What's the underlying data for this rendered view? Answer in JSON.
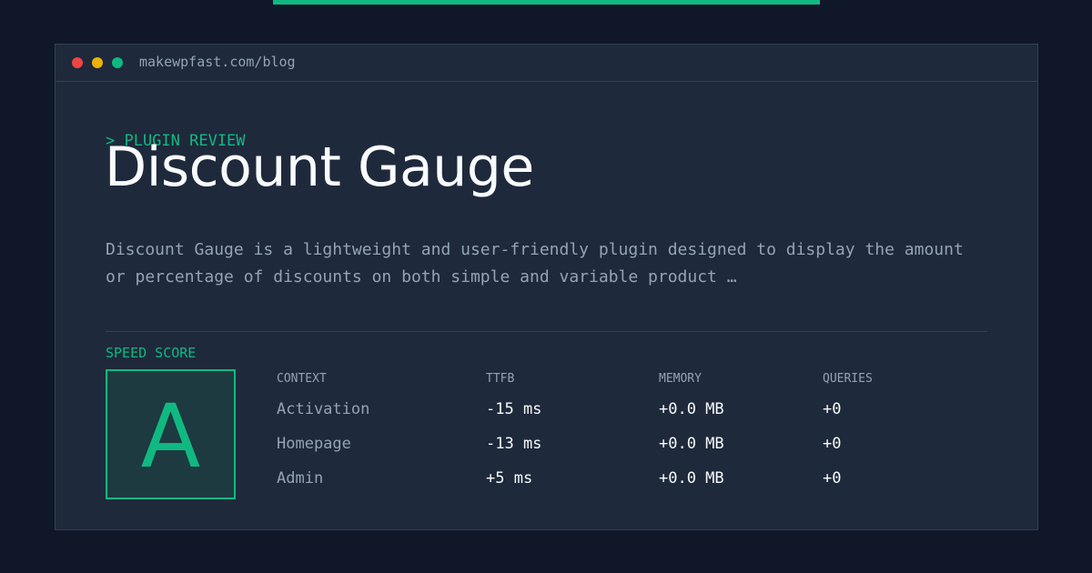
{
  "window": {
    "url": "makewpfast.com/blog"
  },
  "article": {
    "eyebrow": "> PLUGIN REVIEW",
    "title": "Discount Gauge",
    "description": "Discount Gauge is a lightweight and user-friendly plugin designed to display the amount or percentage of discounts on both simple and variable product …"
  },
  "speed": {
    "label": "SPEED SCORE",
    "grade": "A"
  },
  "metrics": {
    "headers": [
      "CONTEXT",
      "TTFB",
      "MEMORY",
      "QUERIES"
    ],
    "rows": [
      [
        "Activation",
        "-15 ms",
        "+0.0 MB",
        "+0"
      ],
      [
        "Homepage",
        "-13 ms",
        "+0.0 MB",
        "+0"
      ],
      [
        "Admin",
        "+5 ms",
        "+0.0 MB",
        "+0"
      ]
    ]
  },
  "colors": {
    "accent": "#10b981",
    "background": "#0f1729",
    "panel": "#1e293b",
    "muted": "#94a3b8",
    "text": "#f8fafc",
    "dot_red": "#ef4444",
    "dot_yellow": "#eab308",
    "dot_green": "#10b981"
  }
}
